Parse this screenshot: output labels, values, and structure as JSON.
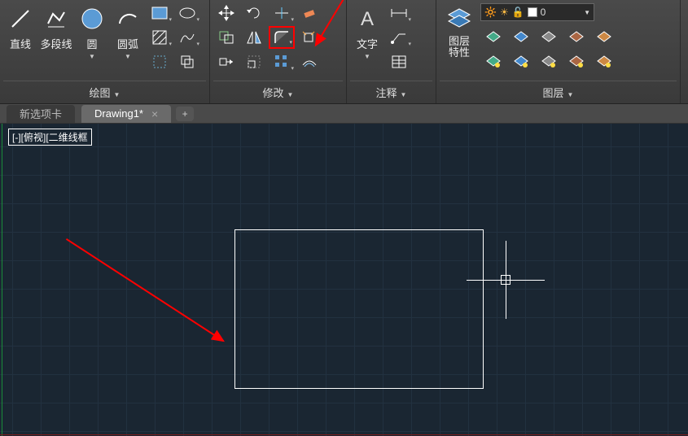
{
  "ribbon": {
    "draw": {
      "title": "绘图",
      "line": "直线",
      "polyline": "多段线",
      "circle": "圆",
      "arc": "圆弧"
    },
    "modify": {
      "title": "修改"
    },
    "annotate": {
      "title": "注释",
      "text": "文字"
    },
    "layers": {
      "title": "图层",
      "properties": "图层\n特性",
      "current": "0"
    }
  },
  "tabs": {
    "newtab": "新选项卡",
    "drawing": "Drawing1*"
  },
  "canvas": {
    "view_label": "[-][俯视][二维线框"
  }
}
